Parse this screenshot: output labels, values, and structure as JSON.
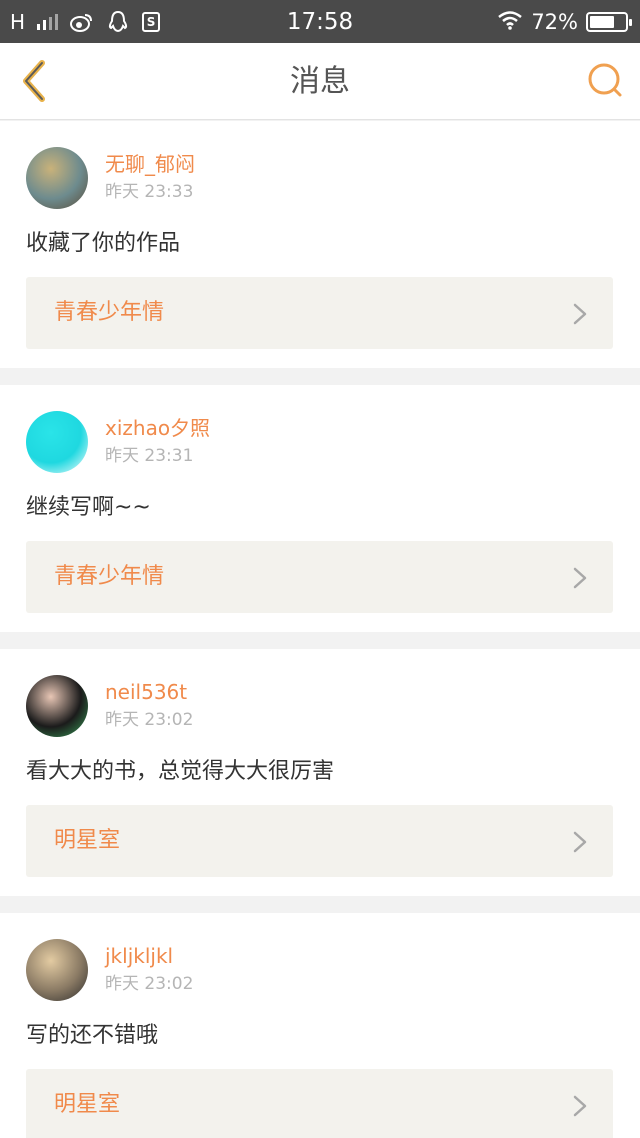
{
  "statusbar": {
    "network": "H",
    "time": "17:58",
    "battery_pct": "72%",
    "battery_level": 0.72,
    "icons": [
      "signal-icon",
      "weibo-icon",
      "qq-icon",
      "s-app-icon",
      "wifi-icon",
      "battery-icon"
    ],
    "s_app_glyph": "S"
  },
  "navbar": {
    "title": "消息",
    "back_icon": "chevron-left-icon",
    "search_icon": "search-icon",
    "accent": "#f0a050"
  },
  "messages": [
    {
      "username": "无聊_郁闷",
      "time": "昨天 23:33",
      "text": "收藏了你的作品",
      "work": "青春少年情",
      "avatar_colors": [
        "#6d8b8e",
        "#c9b27a",
        "#5a4a36"
      ]
    },
    {
      "username": "xizhao夕照",
      "time": "昨天 23:31",
      "text": "继续写啊~~",
      "work": "青春少年情",
      "avatar_colors": [
        "#1fd8e0",
        "#2ae4e8",
        "#ffffff"
      ]
    },
    {
      "username": "neil536t",
      "time": "昨天 23:02",
      "text": "看大大的书，总觉得大大很厉害",
      "work": "明星室",
      "avatar_colors": [
        "#1b1b1b",
        "#e8c6b5",
        "#3aa35a"
      ]
    },
    {
      "username": "jkljkljkl",
      "time": "昨天 23:02",
      "text": "写的还不错哦",
      "work": "明星室",
      "avatar_colors": [
        "#8a7a64",
        "#e3cba2",
        "#2a2a2a"
      ]
    }
  ],
  "colors": {
    "accent": "#f08a4b",
    "statusbar_bg": "#4a4a4a",
    "card_bg": "#ffffff",
    "work_bg": "#f3f2ed"
  }
}
